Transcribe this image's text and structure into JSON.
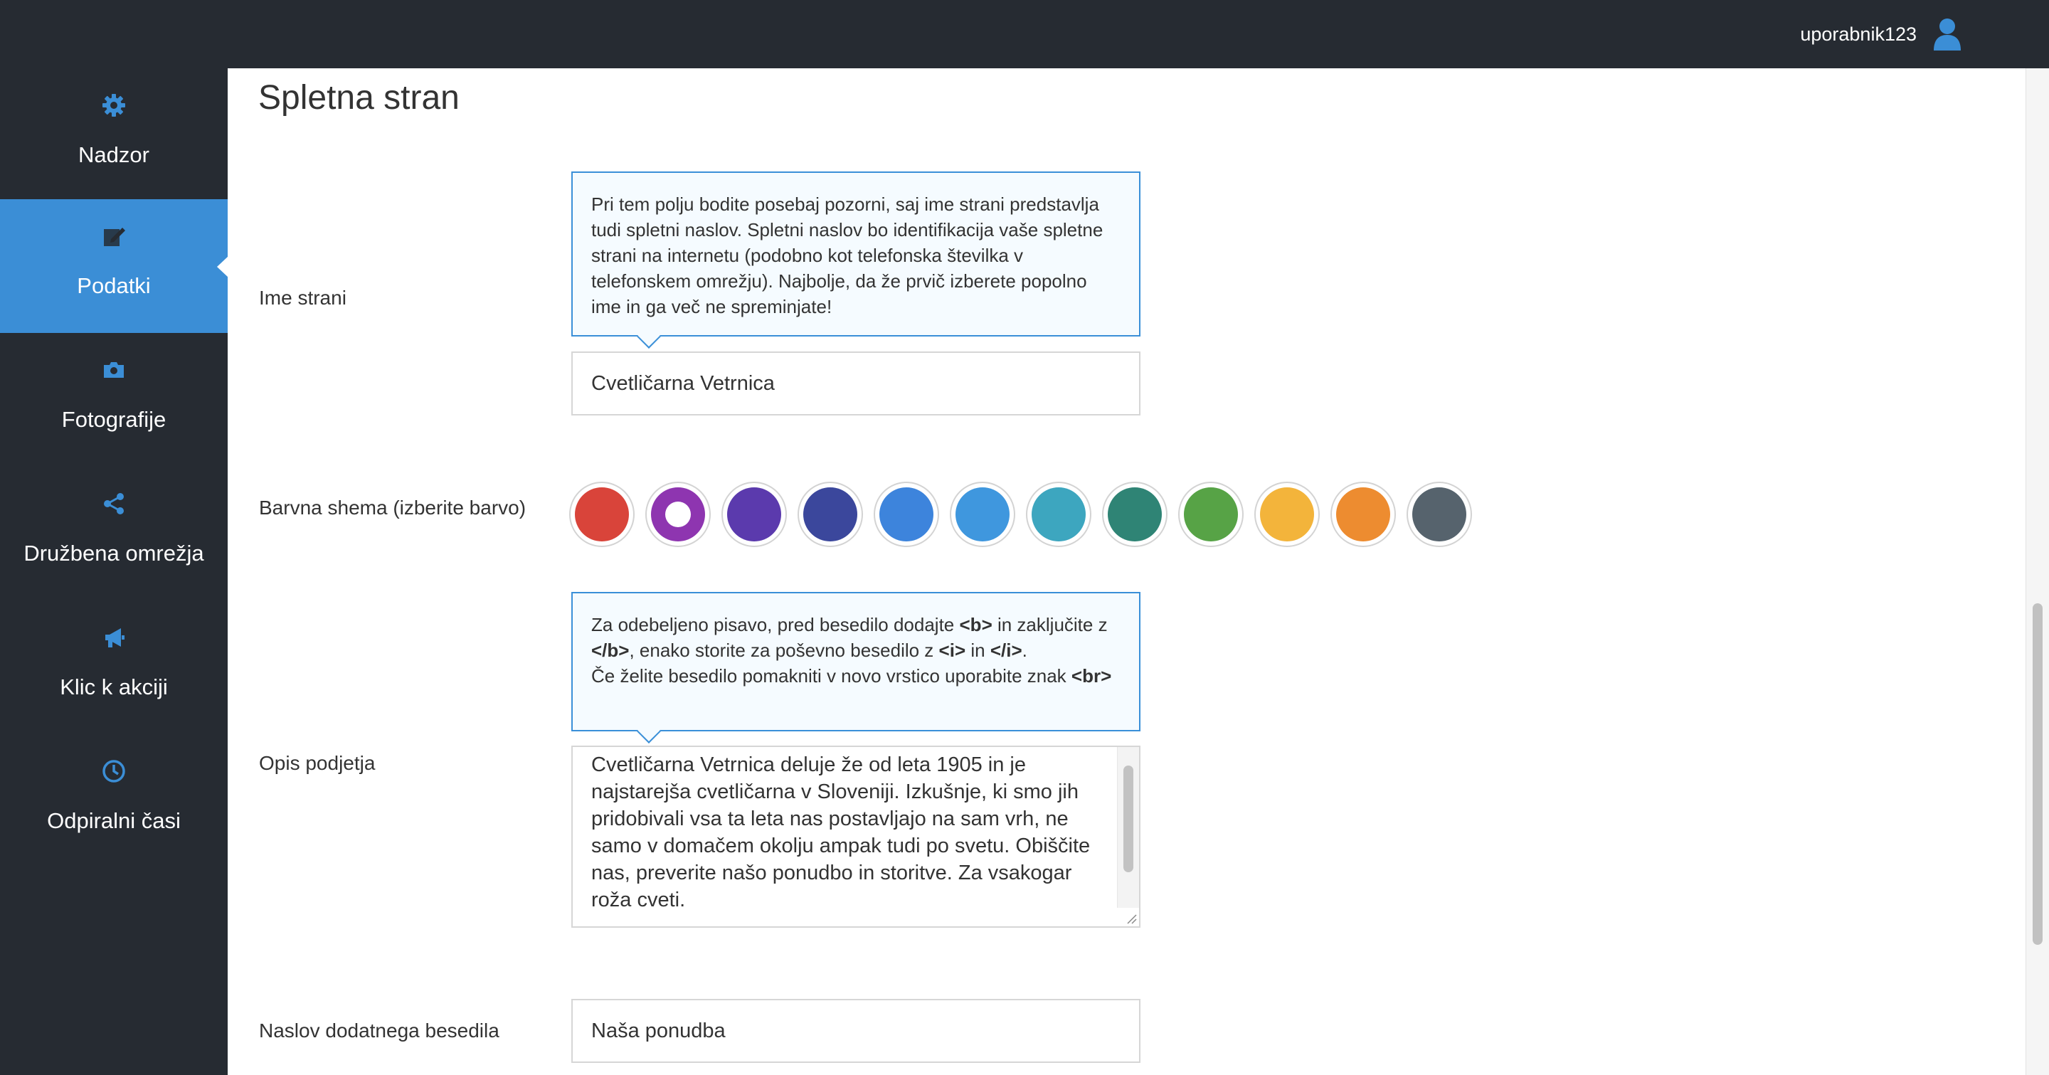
{
  "header": {
    "username": "uporabnik123",
    "user_icon": "user-icon"
  },
  "sidebar": {
    "items": [
      {
        "label": "Nadzor",
        "icon": "gear-icon",
        "active": false
      },
      {
        "label": "Podatki",
        "icon": "edit-icon",
        "active": true
      },
      {
        "label": "Fotografije",
        "icon": "camera-icon",
        "active": false
      },
      {
        "label": "Družbena omrežja",
        "icon": "share-icon",
        "active": false
      },
      {
        "label": "Klic k akciji",
        "icon": "megaphone-icon",
        "active": false
      },
      {
        "label": "Odpiralni časi",
        "icon": "clock-icon",
        "active": false
      }
    ],
    "active_color": "#3b8ed6",
    "background_color": "#262b32"
  },
  "main": {
    "title": "Spletna stran",
    "site_name": {
      "label": "Ime strani",
      "tip": "Pri tem polju bodite posebaj pozorni, saj ime strani predstavlja tudi spletni naslov. Spletni naslov bo identifikacija vaše spletne strani na internetu (podobno kot telefonska številka v telefonskem omrežju). Najbolje, da že prvič izberete popolno ime in ga več ne spreminjate!",
      "value": "Cvetličarna Vetrnica"
    },
    "color_scheme": {
      "label": "Barvna shema (izberite barvo)",
      "colors": [
        "#d9443a",
        "#8e35b0",
        "#5b3aad",
        "#3b479c",
        "#3d84dc",
        "#3f97de",
        "#3da6bf",
        "#2f8475",
        "#57a346",
        "#f3b43b",
        "#ed8c30",
        "#56636d"
      ],
      "selected_index": 1
    },
    "description": {
      "label": "Opis podjetja",
      "tip": {
        "p1_a": "Za odebeljeno pisavo, pred besedilo dodajte ",
        "p1_b": "<b>",
        "p1_c": " in zaključite z ",
        "p1_d": "</b>",
        "p1_e": ", enako storite za poševno besedilo z ",
        "p1_f": "<i>",
        "p1_g": " in ",
        "p1_h": "</i>",
        "p1_i": ".",
        "p2_a": "Če želite besedilo pomakniti v novo vrstico uporabite znak ",
        "p2_b": "<br>"
      },
      "value": "Cvetličarna Vetrnica deluje že od leta 1905 in je najstarejša cvetličarna v Sloveniji. Izkušnje, ki smo jih pridobivali vsa ta leta nas postavljajo na sam vrh, ne samo v domačem okolju ampak tudi po svetu. Obiščite nas, preverite našo ponudbo in storitve. Za vsakogar roža cveti."
    },
    "extra_title": {
      "label": "Naslov dodatnega besedila",
      "value": "Naša ponudba"
    }
  }
}
